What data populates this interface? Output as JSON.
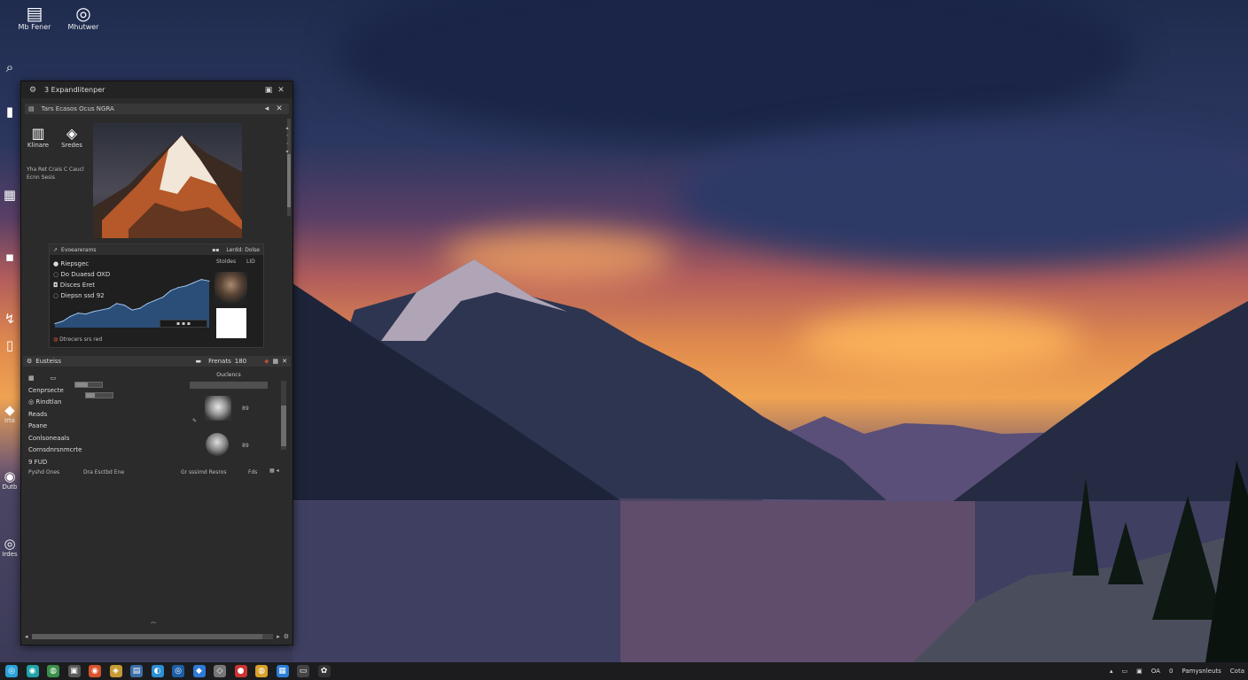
{
  "desktop": {
    "top_icons": [
      {
        "label": "Mb Fener",
        "icon": "folder-icon"
      },
      {
        "label": "Mhutwer",
        "icon": "target-icon"
      }
    ],
    "side_icons": [
      {
        "label": "",
        "icon": "search-icon"
      },
      {
        "label": "",
        "icon": "bookmark-icon"
      },
      {
        "label": "",
        "icon": "grid-icon"
      },
      {
        "label": "",
        "icon": "pin-icon"
      },
      {
        "label": "",
        "icon": "share-icon"
      },
      {
        "label": "",
        "icon": "file-icon"
      },
      {
        "label": "Irta",
        "icon": "diamond-icon"
      },
      {
        "label": "Dutb",
        "icon": "disc-icon"
      },
      {
        "label": "Irdes",
        "icon": "record-icon"
      }
    ]
  },
  "window": {
    "title": "3 Expandlitenper",
    "subbar_label": "Tars Ecasos Ocus NGRA",
    "tools": [
      {
        "label": "Klinare",
        "icon": "column-icon"
      },
      {
        "label": "Sredes",
        "icon": "layers-icon"
      }
    ],
    "meta_lines": [
      "Yha Ret Crais C Caucl",
      "Ecnn Sesis"
    ],
    "chart_panel": {
      "title": "Evoearerams",
      "title_right": "Lerdd: Dolse",
      "list": [
        "Riepsgec",
        "Do Duaesd OXD",
        "Disces Eret",
        "Diepsn ssd 92"
      ],
      "right_label_1": "Stoldes",
      "right_label_2": "LID",
      "footer": "Dtrecers srs red"
    },
    "section": {
      "title": "Eusteiss",
      "right_label": "Frenats",
      "right_value": "180",
      "items": [
        "Cenprsecte",
        "Rindtlan",
        "Reads",
        "Paane",
        "Conlsoneaals",
        "Cornsdnrsnmcrte",
        "9 FUD"
      ],
      "pane_label": "Ouclencs",
      "tag1": "89",
      "tag2": "89",
      "footer_left": "Pyshd Ones",
      "footer_mid": "Dra Esctbd Ene",
      "footer_right": "Gr sssimd Resros",
      "footer_end": "Fds"
    }
  },
  "chart_data": {
    "type": "area",
    "title": "",
    "xlabel": "",
    "ylabel": "",
    "x": [
      0,
      1,
      2,
      3,
      4,
      5,
      6,
      7,
      8,
      9,
      10,
      11,
      12,
      13,
      14,
      15,
      16,
      17,
      18,
      19,
      20
    ],
    "series": [
      {
        "values": [
          5,
          8,
          14,
          18,
          17,
          20,
          22,
          24,
          30,
          28,
          22,
          24,
          30,
          34,
          38,
          46,
          50,
          52,
          56,
          60,
          58
        ]
      }
    ],
    "ylim": [
      0,
      64
    ],
    "grid": false,
    "colors": {
      "line": "#9fc3ee",
      "fill": "#2f5f95"
    }
  },
  "taskbar": {
    "icons": [
      {
        "name": "start-icon",
        "glyph": "◎",
        "color": "#2aa2d9"
      },
      {
        "name": "browser-icon",
        "glyph": "◉",
        "color": "#1fa3a8"
      },
      {
        "name": "chrome-icon",
        "glyph": "◍",
        "color": "#3a8f4a"
      },
      {
        "name": "mail-icon",
        "glyph": "▣",
        "color": "#5a5a5a"
      },
      {
        "name": "music-icon",
        "glyph": "◉",
        "color": "#d9532a"
      },
      {
        "name": "store-icon",
        "glyph": "◈",
        "color": "#c59a32"
      },
      {
        "name": "calendar-icon",
        "glyph": "▤",
        "color": "#3b6ea8"
      },
      {
        "name": "edge-icon",
        "glyph": "◐",
        "color": "#2c8fd6"
      },
      {
        "name": "app-icon",
        "glyph": "◎",
        "color": "#1d5fa8"
      },
      {
        "name": "drive-icon",
        "glyph": "◆",
        "color": "#2d7ad9"
      },
      {
        "name": "photos-icon",
        "glyph": "◇",
        "color": "#777"
      },
      {
        "name": "record-icon",
        "glyph": "●",
        "color": "#c33"
      },
      {
        "name": "chrome2-icon",
        "glyph": "◍",
        "color": "#d9a12a"
      },
      {
        "name": "files-icon",
        "glyph": "▦",
        "color": "#2a7fd9"
      },
      {
        "name": "terminal-icon",
        "glyph": "▭",
        "color": "#444"
      },
      {
        "name": "settings-icon",
        "glyph": "✿",
        "color": "#333"
      }
    ],
    "tray": [
      "OA",
      "0",
      "Pamysnleuts",
      "Cota"
    ]
  }
}
